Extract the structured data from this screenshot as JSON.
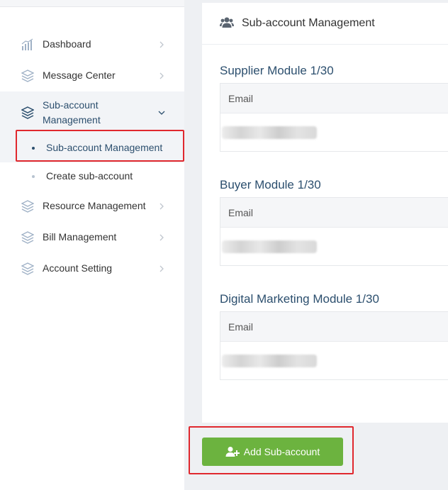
{
  "sidebar": {
    "items": [
      {
        "label": "Dashboard",
        "icon": "bar-chart-icon"
      },
      {
        "label": "Message Center",
        "icon": "layers-icon"
      },
      {
        "label": "Sub-account\nManagement",
        "label_line1": "Sub-account",
        "label_line2": "Management",
        "icon": "layers-icon",
        "expanded": true
      },
      {
        "label": "Resource Management",
        "icon": "layers-icon"
      },
      {
        "label": "Bill Management",
        "icon": "layers-icon"
      },
      {
        "label": "Account Setting",
        "icon": "layers-icon"
      }
    ],
    "sub_items": [
      {
        "label": "Sub-account Management",
        "active": true
      },
      {
        "label": "Create sub-account",
        "active": false
      }
    ]
  },
  "main": {
    "title": "Sub-account Management",
    "modules": [
      {
        "title": "Supplier Module 1/30",
        "column_header": "Email"
      },
      {
        "title": "Buyer Module 1/30",
        "column_header": "Email"
      },
      {
        "title": "Digital Marketing Module 1/30",
        "column_header": "Email"
      }
    ],
    "add_button_label": "Add Sub-account"
  },
  "colors": {
    "accent": "#2c4f6e",
    "button_green": "#6cb33f",
    "highlight_red": "#e0282e",
    "icon_blue": "#9fb1c6"
  }
}
